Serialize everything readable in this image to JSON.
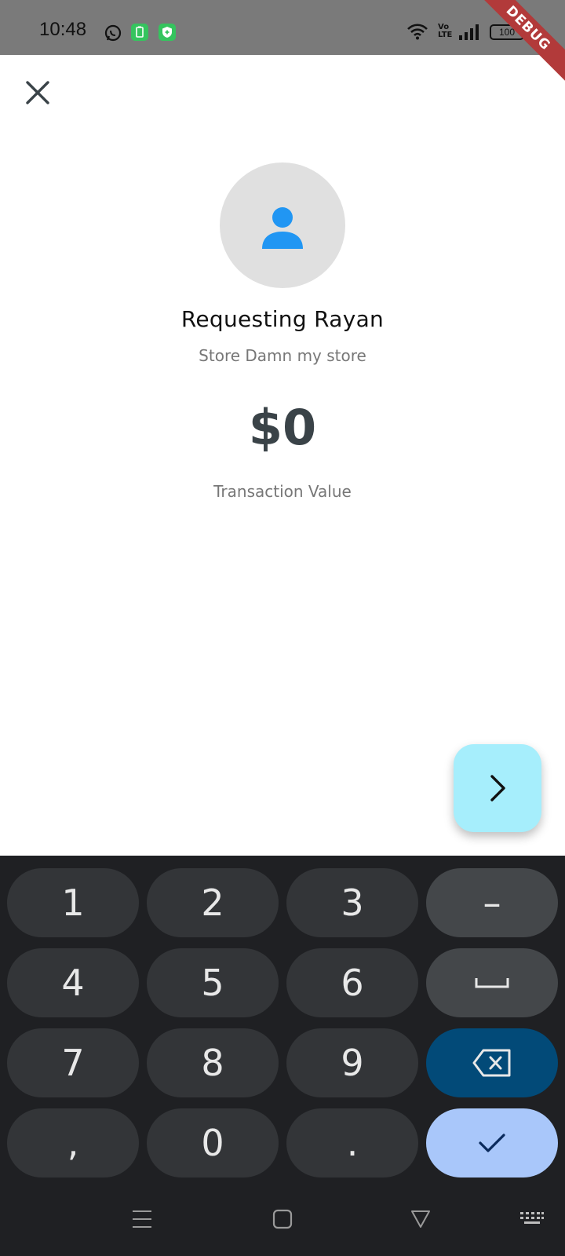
{
  "status_bar": {
    "time": "10:48",
    "volte": "Vo\nLTE",
    "battery": "100",
    "debug_label": "DEBUG"
  },
  "header": {
    "close_icon": "close-icon"
  },
  "request": {
    "title": "Requesting Rayan",
    "subtitle": "Store Damn my store",
    "amount": "$0",
    "amount_caption": "Transaction Value",
    "avatar_icon": "person-icon"
  },
  "fab": {
    "icon": "chevron-right-icon",
    "color": "#a6eefc"
  },
  "keypad": {
    "keys": [
      "1",
      "2",
      "3",
      "–",
      "4",
      "5",
      "6",
      "space",
      "7",
      "8",
      "9",
      "backspace",
      ",",
      "0",
      ".",
      "done"
    ],
    "labels": {
      "k1": "1",
      "k2": "2",
      "k3": "3",
      "minus": "–",
      "k4": "4",
      "k5": "5",
      "k6": "6",
      "k7": "7",
      "k8": "8",
      "k9": "9",
      "comma": ",",
      "k0": "0",
      "dot": "."
    },
    "colors": {
      "background": "#1f2023",
      "key": "#333538",
      "function_key": "#44474a",
      "backspace": "#024a78",
      "done": "#a9c7fa"
    }
  },
  "nav_bar": {
    "icons": [
      "menu-icon",
      "home-icon",
      "back-icon",
      "keyboard-icon"
    ]
  }
}
